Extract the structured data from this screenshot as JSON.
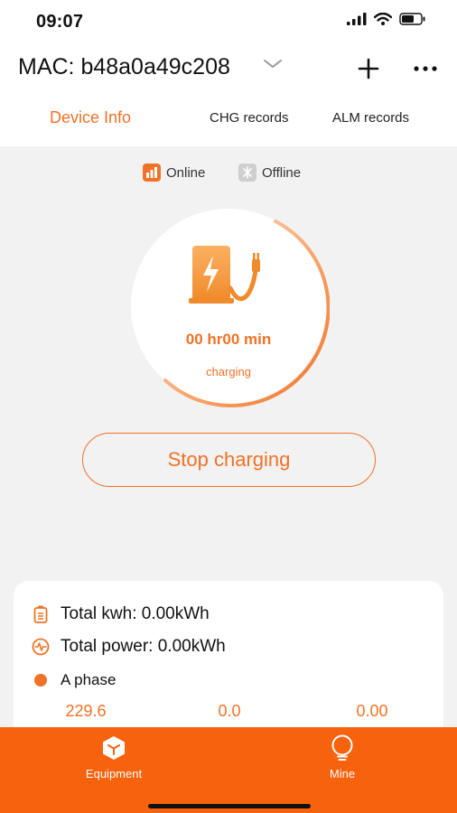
{
  "status_bar": {
    "time": "09:07",
    "icons": [
      "signal-icon",
      "wifi-icon",
      "battery-icon"
    ]
  },
  "header": {
    "title": "MAC: b48a0a49c208",
    "icons": {
      "dropdown": "chevron-down-icon",
      "add": "plus-icon",
      "more": "more-dots-icon"
    }
  },
  "tabs": [
    {
      "label": "Device Info",
      "active": true
    },
    {
      "label": "CHG records",
      "active": false
    },
    {
      "label": "ALM records",
      "active": false
    }
  ],
  "legend": {
    "online_label": "Online",
    "offline_label": "Offline"
  },
  "dial": {
    "icon": "charger-icon",
    "time": "00 hr00 min",
    "state": "charging"
  },
  "stop_button": {
    "label": "Stop charging"
  },
  "card": {
    "total_kwh": "Total kwh: 0.00kWh",
    "total_power": "Total power: 0.00kWh",
    "phase": "A phase",
    "values": [
      "229.6",
      "0.0",
      "0.00"
    ]
  },
  "tabbar": {
    "items": [
      {
        "label": "Equipment",
        "icon": "cube-icon"
      },
      {
        "label": "Mine",
        "icon": "lightbulb-icon"
      }
    ]
  },
  "colors": {
    "accent": "#f07226",
    "tabbar": "#f7620d",
    "background": "#f2f2f2"
  }
}
